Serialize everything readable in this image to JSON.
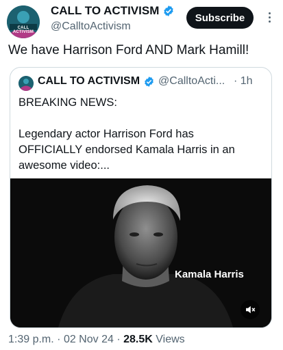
{
  "author": {
    "display_name": "CALL TO ACTIVISM",
    "handle": "@CalltoActivism",
    "avatar_text": "CALL ACTIVISM"
  },
  "subscribe_label": "Subscribe",
  "tweet_text": "We have Harrison Ford AND Mark Hamill!",
  "quote": {
    "display_name": "CALL TO ACTIVISM",
    "handle": "@CalltoActi...",
    "time": "· 1h",
    "lines": [
      "BREAKING NEWS:",
      "Legendary actor Harrison Ford has",
      "OFFICIALLY endorsed Kamala Harris in an",
      "awesome  video:..."
    ],
    "video_caption": "Kamala Harris"
  },
  "meta": {
    "time": "1:39 p.m.",
    "date": "02 Nov 24",
    "views_count": "28.5K",
    "views_label": "Views"
  },
  "colors": {
    "verified": "#1d9bf0",
    "secondary_text": "#536471",
    "primary_text": "#0f1419"
  },
  "icons": [
    "verified-badge-icon",
    "more-options-icon",
    "muted-speaker-icon"
  ]
}
